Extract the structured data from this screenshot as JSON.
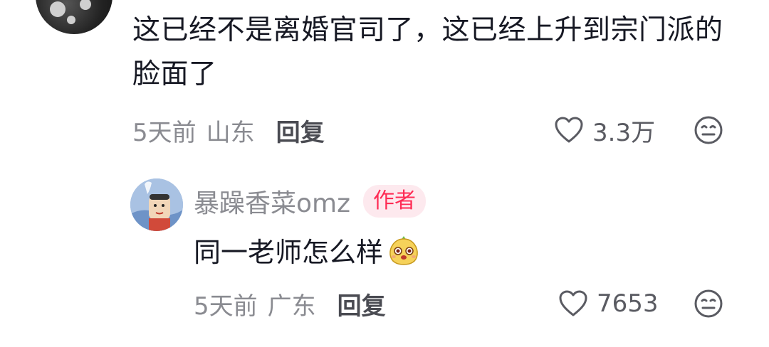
{
  "top_comment": {
    "text": "这已经不是离婚官司了，这已经上升到宗门派的脸面了",
    "time": "5天前",
    "location": "山东",
    "reply_label": "回复",
    "likes": "3.3万"
  },
  "reply": {
    "username": "暴躁香菜omz",
    "badge": "作者",
    "text": "同一老师怎么样",
    "emoji": "smiling-mango-sticker",
    "time": "5天前",
    "location": "广东",
    "reply_label": "回复",
    "likes": "7653"
  },
  "colors": {
    "text_primary": "#161823",
    "text_secondary": "#8a8b91",
    "badge_bg": "#fde9ee",
    "badge_text": "#fe2c55"
  }
}
